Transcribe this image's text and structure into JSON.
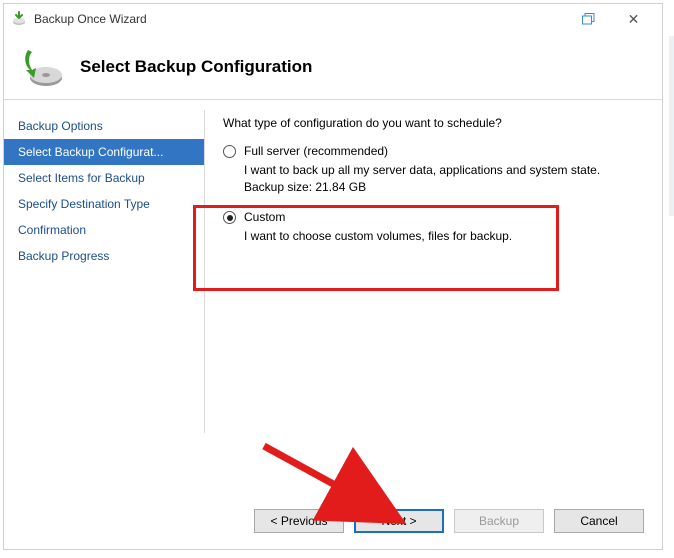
{
  "titlebar": {
    "title": "Backup Once Wizard"
  },
  "header": {
    "title": "Select Backup Configuration"
  },
  "sidebar": {
    "items": [
      {
        "label": "Backup Options",
        "selected": false
      },
      {
        "label": "Select Backup Configurat...",
        "selected": true
      },
      {
        "label": "Select Items for Backup",
        "selected": false
      },
      {
        "label": "Specify Destination Type",
        "selected": false
      },
      {
        "label": "Confirmation",
        "selected": false
      },
      {
        "label": "Backup Progress",
        "selected": false
      }
    ]
  },
  "content": {
    "prompt": "What type of configuration do you want to schedule?",
    "full": {
      "title": "Full server (recommended)",
      "desc": "I want to back up all my server data, applications and system state.",
      "size_label": "Backup size: 21.84 GB",
      "checked": false
    },
    "custom": {
      "title": "Custom",
      "desc": "I want to choose custom volumes, files for backup.",
      "checked": true
    }
  },
  "footer": {
    "previous": "< Previous",
    "next": "Next >",
    "backup": "Backup",
    "cancel": "Cancel"
  }
}
